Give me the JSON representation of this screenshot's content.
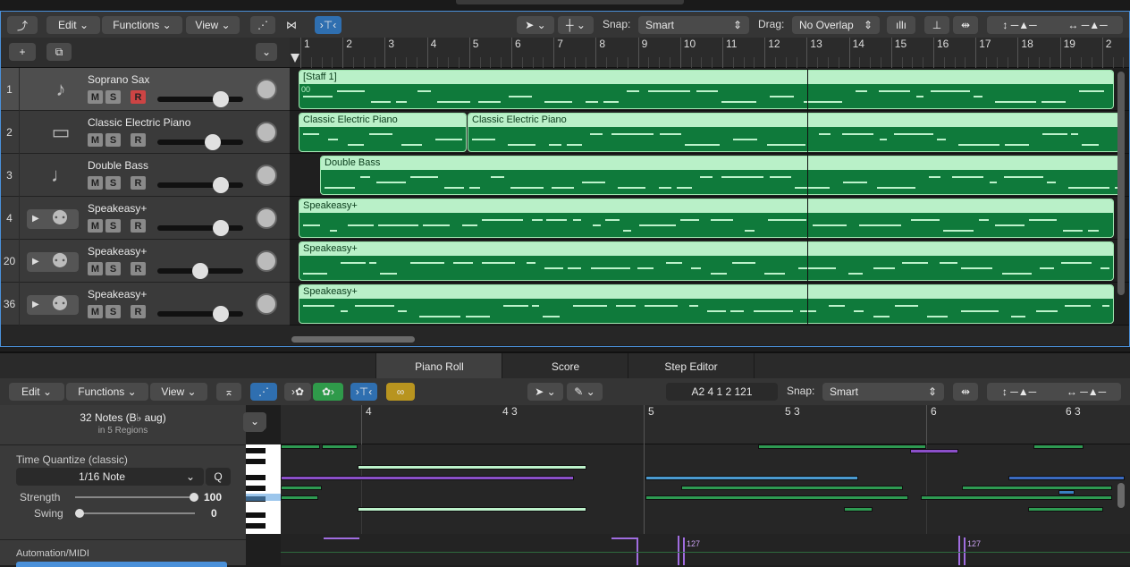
{
  "top_toolbar": {
    "edit": "Edit",
    "functions": "Functions",
    "view": "View",
    "snap_label": "Snap:",
    "snap_value": "Smart",
    "drag_label": "Drag:",
    "drag_value": "No Overlap"
  },
  "ruler": {
    "bars": [
      "1",
      "2",
      "3",
      "4",
      "5",
      "6",
      "7",
      "8",
      "9",
      "10",
      "11",
      "12",
      "13",
      "14",
      "15",
      "16",
      "17",
      "18",
      "19",
      "2"
    ]
  },
  "tracks": [
    {
      "num": "1",
      "name": "Soprano Sax",
      "m": "M",
      "s": "S",
      "r": "R",
      "vol": 0.74
    },
    {
      "num": "2",
      "name": "Classic Electric Piano",
      "m": "M",
      "s": "S",
      "r": "R",
      "vol": 0.65
    },
    {
      "num": "3",
      "name": "Double Bass",
      "m": "M",
      "s": "S",
      "r": "R",
      "vol": 0.74
    },
    {
      "num": "4",
      "name": "Speakeasy+",
      "m": "M",
      "s": "S",
      "r": "R",
      "vol": 0.74
    },
    {
      "num": "20",
      "name": "Speakeasy+",
      "m": "M",
      "s": "S",
      "r": "R",
      "vol": 0.5
    },
    {
      "num": "36",
      "name": "Speakeasy+",
      "m": "M",
      "s": "S",
      "r": "R",
      "vol": 0.74
    }
  ],
  "regions": {
    "r1": "[Staff 1]",
    "r1b": "00",
    "r2a": "Classic Electric Piano",
    "r2b": "Classic Electric Piano",
    "r3": "Double Bass",
    "r4": "Speakeasy+",
    "r5": "Speakeasy+",
    "r6": "Speakeasy+"
  },
  "tabs": [
    "Piano Roll",
    "Score",
    "Step Editor"
  ],
  "editor_toolbar": {
    "edit": "Edit",
    "functions": "Functions",
    "view": "View",
    "position": "A2   4 1 2 121",
    "snap_label": "Snap:",
    "snap_value": "Smart"
  },
  "inspector": {
    "notes_title": "32 Notes (B♭ aug)",
    "notes_sub": "in 5 Regions",
    "quantize_label": "Time Quantize (classic)",
    "quantize_value": "1/16 Note",
    "q_button": "Q",
    "strength_label": "Strength",
    "strength_value": "100",
    "swing_label": "Swing",
    "swing_value": "0",
    "automation_label": "Automation/MIDI"
  },
  "pr_ruler": {
    "m1": "4",
    "m2": "4 3",
    "m3": "5",
    "m4": "5 3",
    "m5": "6",
    "m6": "6 3"
  },
  "automation_values": {
    "a1": "127",
    "a2": "127"
  }
}
